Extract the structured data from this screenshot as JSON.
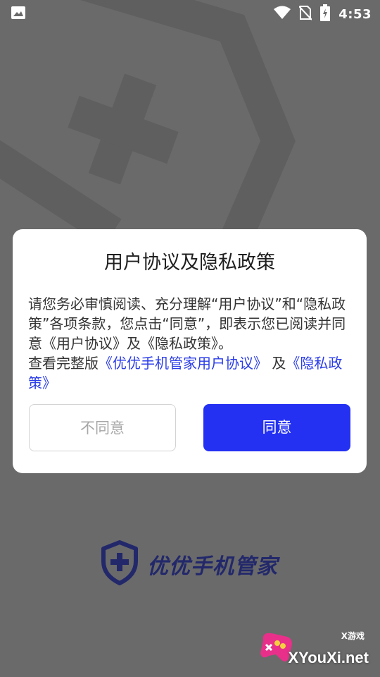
{
  "status_bar": {
    "time": "4:53",
    "icons": [
      "image-icon",
      "wifi-icon",
      "no-sim-icon",
      "battery-icon"
    ]
  },
  "dialog": {
    "title": "用户协议及隐私政策",
    "paragraph1": "请您务必审慎阅读、充分理解“用户协议”和“隐私政策”各项条款，您点击“同意”，即表示您已阅读并同意《用户协议》及《隐私政策》。",
    "paragraph2_prefix": "查看完整版",
    "link_user_agreement": "《优优手机管家用户协议》",
    "paragraph2_middle": "及",
    "link_privacy_policy": "《隐私政策》",
    "disagree_label": "不同意",
    "agree_label": "同意"
  },
  "brand": {
    "name": "优优手机管家",
    "icon": "shield-plus-icon"
  },
  "watermark": {
    "small_text": "X游戏",
    "big_text": "XYouXi.net",
    "icon": "gamepad-icon"
  },
  "colors": {
    "accent": "#2431f2",
    "link": "#2b3de8",
    "brand_text": "#22286a",
    "overlay_bg": "#6a6a6a"
  }
}
